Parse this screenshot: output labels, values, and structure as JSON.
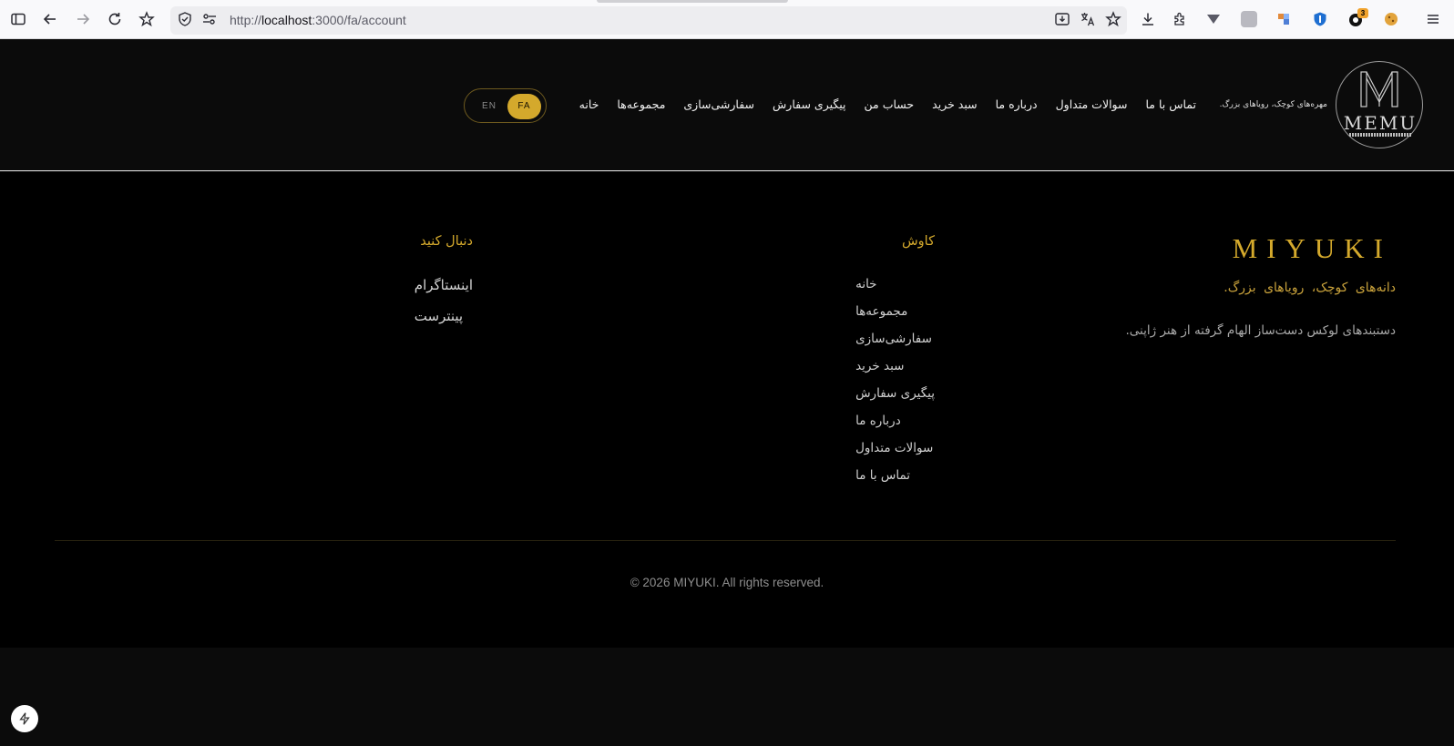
{
  "browser": {
    "url_prefix": "http://",
    "url_host": "localhost",
    "url_rest": ":3000/fa/account",
    "extension_badge": "3"
  },
  "header": {
    "logo_word": "MEMU",
    "tagline": "مهره‌های کوچک، رویاهای بزرگ.",
    "nav": [
      "خانه",
      "مجموعه‌ها",
      "سفارشی‌سازی",
      "پیگیری سفارش",
      "حساب من",
      "سبد خرید",
      "درباره ما",
      "سوالات متداول",
      "تماس با ما"
    ],
    "lang_en": "EN",
    "lang_fa": "FA",
    "active_lang": "FA"
  },
  "footer": {
    "brand": "MIYUKI",
    "tagline": "دانه‌های کوچک، رویاهای بزرگ.",
    "description": "دستبندهای لوکس دست‌ساز الهام گرفته از هنر ژاپنی.",
    "explore_title": "کاوش",
    "explore_links": [
      "خانه",
      "مجموعه‌ها",
      "سفارشی‌سازی",
      "سبد خرید",
      "پیگیری سفارش",
      "درباره ما",
      "سوالات متداول",
      "تماس با ما"
    ],
    "follow_title": "دنبال کنید",
    "social_links": [
      "اینستاگرام",
      "پینترست"
    ],
    "copyright": "© 2026 MIYUKI. All rights reserved."
  },
  "colors": {
    "accent": "#d4a92c",
    "background": "#000000",
    "header_bg": "#0b0b0b"
  },
  "icons": [
    "sidebar-icon",
    "back-icon",
    "forward-icon",
    "reload-icon",
    "bookmark-page-icon",
    "shield-icon",
    "permissions-icon",
    "install-icon",
    "translate-icon",
    "star-icon",
    "download-icon",
    "extensions-icon",
    "lightning-icon"
  ]
}
